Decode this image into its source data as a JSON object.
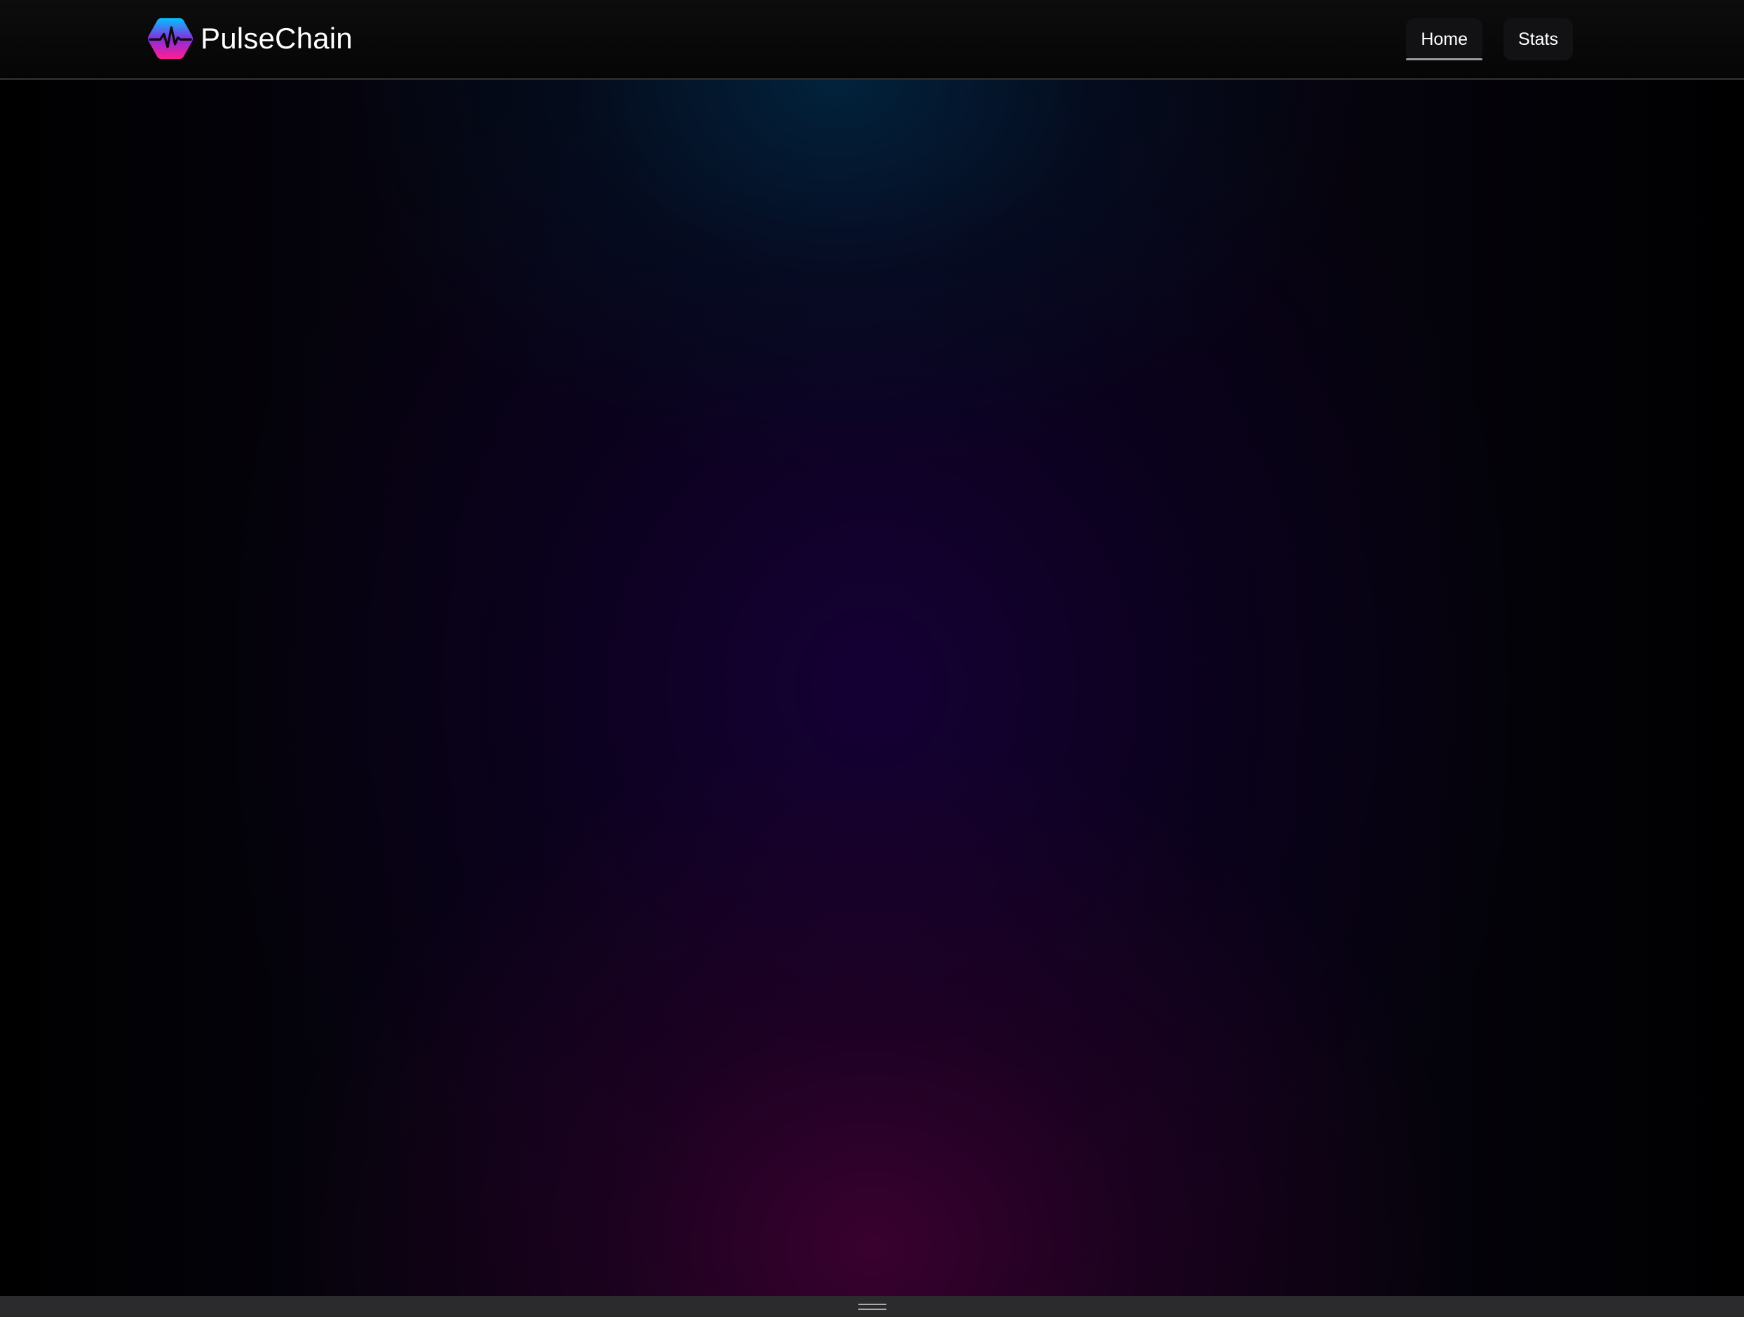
{
  "header": {
    "brand": {
      "name": "PulseChain",
      "logo_icon": "pulse-hexagon-icon"
    },
    "nav": [
      {
        "label": "Home",
        "active": true
      },
      {
        "label": "Stats",
        "active": false
      }
    ]
  },
  "colors": {
    "background": "#000000",
    "header_background": "#0a0a0b",
    "nav_button": "#121214",
    "text": "#ffffff",
    "logo_gradient": [
      "#00c2ff",
      "#8a2be2",
      "#ff1f8e"
    ],
    "hero_glow_top": "#00283f",
    "hero_glow_middle": "#160036",
    "hero_glow_bottom": "#460034"
  },
  "footer": {
    "handle_icon": "drag-handle-icon"
  }
}
